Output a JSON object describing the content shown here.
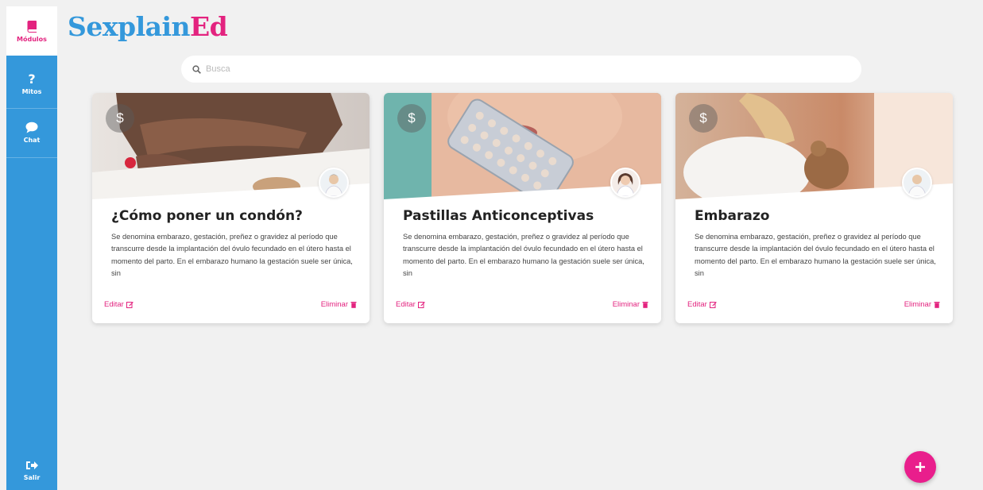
{
  "app": {
    "logo_part1": "Sexplain",
    "logo_part2": "Ed",
    "brand_blue": "#3498db",
    "brand_pink": "#e3237f"
  },
  "sidebar": {
    "items": [
      {
        "label": "Módulos",
        "icon": "book-icon",
        "active": true
      },
      {
        "label": "Mitos",
        "icon": "question-icon",
        "active": false
      },
      {
        "label": "Chat",
        "icon": "chat-bubble-icon",
        "active": false
      }
    ],
    "logout": {
      "label": "Salir",
      "icon": "sign-out-icon"
    }
  },
  "search": {
    "placeholder": "Busca",
    "icon": "search-icon"
  },
  "cards": [
    {
      "title": "¿Cómo poner un condón?",
      "description": "Se denomina embarazo, gestación, preñez o gravidez al período que transcurre desde la implantación del óvulo fecundado en el útero hasta el momento del parto. En el embarazo humano la gestación suele ser única, sin",
      "badge": "$",
      "edit_label": "Editar",
      "delete_label": "Eliminar"
    },
    {
      "title": "Pastillas Anticonceptivas",
      "description": "Se denomina embarazo, gestación, preñez o gravidez al período que transcurre desde la implantación del óvulo fecundado en el útero hasta el momento del parto. En el embarazo humano la gestación suele ser única, sin",
      "badge": "$",
      "edit_label": "Editar",
      "delete_label": "Eliminar"
    },
    {
      "title": "Embarazo",
      "description": "Se denomina embarazo, gestación, preñez o gravidez al período que transcurre desde la implantación del óvulo fecundado en el útero hasta el momento del parto. En el embarazo humano la gestación suele ser única, sin",
      "badge": "$",
      "edit_label": "Editar",
      "delete_label": "Eliminar"
    }
  ],
  "fab": {
    "icon": "plus-icon"
  }
}
